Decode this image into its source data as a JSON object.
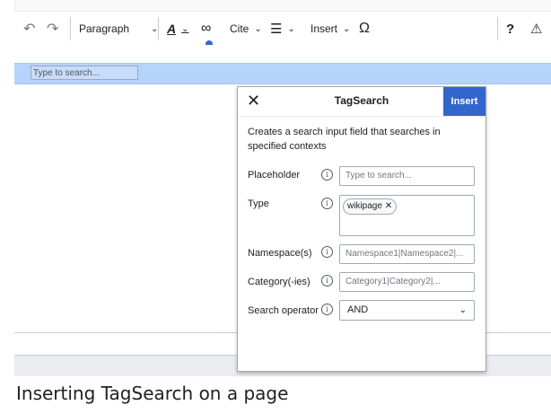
{
  "toolbar": {
    "undo_icon": "undo-icon",
    "redo_icon": "redo-icon",
    "paragraph_label": "Paragraph",
    "text_style_label": "A",
    "link_icon": "link-icon",
    "cite_label": "Cite",
    "list_icon": "list-icon",
    "insert_label": "Insert",
    "special_char_label": "Ω",
    "help_label": "?",
    "notice_label": "⚠"
  },
  "editor": {
    "inline_input_placeholder": "Type to search..."
  },
  "dialog": {
    "close_label": "✕",
    "title": "TagSearch",
    "insert_label": "Insert",
    "description": "Creates a search input field that searches in specified contexts",
    "fields": {
      "placeholder": {
        "label": "Placeholder",
        "placeholder": "Type to search..."
      },
      "type": {
        "label": "Type",
        "tag": "wikipage"
      },
      "namespace": {
        "label": "Namespace(s)",
        "placeholder": "Namespace1|Namespace2|..."
      },
      "category": {
        "label": "Category(-ies)",
        "placeholder": "Category1|Category2|..."
      },
      "operator": {
        "label": "Search operator",
        "value": "AND"
      }
    },
    "info_glyph": "i"
  },
  "caption": "Inserting TagSearch on a page",
  "colors": {
    "accent": "#3366cc",
    "highlight": "#b6d4fb"
  }
}
